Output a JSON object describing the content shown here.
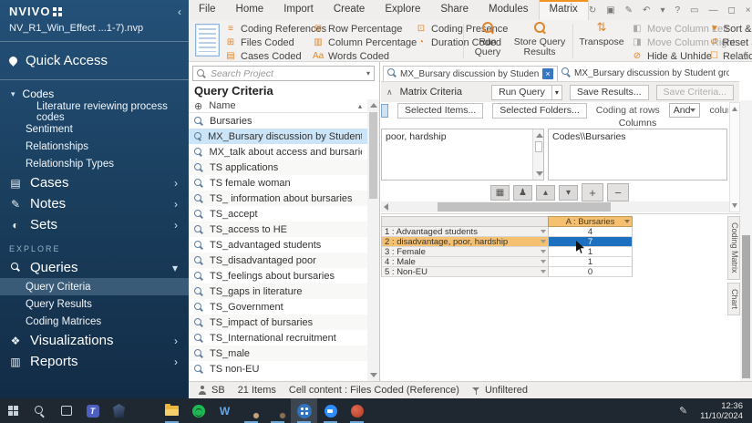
{
  "sidebar": {
    "logo_text": "NVIVO",
    "collapse_glyph": "‹",
    "project_name": "NV_R1_Win_Effect ...1-7).nvp",
    "quick_access_label": "Quick Access",
    "codes": {
      "label": "Codes",
      "chevron": "▾"
    },
    "codes_children": [
      {
        "label": "Literature reviewing process codes",
        "deep": true
      },
      {
        "label": "Sentiment"
      },
      {
        "label": "Relationships"
      },
      {
        "label": "Relationship Types"
      }
    ],
    "sections": [
      {
        "label": "Cases",
        "glyph": "▤",
        "chevron": "›"
      },
      {
        "label": "Notes",
        "glyph": "✎",
        "chevron": "›"
      },
      {
        "label": "Sets",
        "glyph": "◐",
        "chevron": "›"
      }
    ],
    "explore_label": "EXPLORE",
    "queries": {
      "label": "Queries",
      "chevron": "▾"
    },
    "queries_children": [
      {
        "label": "Query Criteria",
        "selected": true
      },
      {
        "label": "Query Results"
      },
      {
        "label": "Coding Matrices"
      }
    ],
    "bottom_sections": [
      {
        "label": "Visualizations",
        "glyph": "❖",
        "chevron": "›"
      },
      {
        "label": "Reports",
        "glyph": "▥",
        "chevron": "›"
      }
    ]
  },
  "ribbon": {
    "tabs": [
      {
        "label": "File"
      },
      {
        "label": "Home"
      },
      {
        "label": "Import"
      },
      {
        "label": "Create"
      },
      {
        "label": "Explore"
      },
      {
        "label": "Share"
      },
      {
        "label": "Modules"
      },
      {
        "label": "Matrix",
        "active": true
      }
    ],
    "window_icons": [
      {
        "glyph": "↻"
      },
      {
        "glyph": "▣"
      },
      {
        "glyph": "✎"
      },
      {
        "glyph": "↶"
      },
      {
        "glyph": "▾"
      },
      {
        "glyph": "?"
      },
      {
        "glyph": "▭"
      },
      {
        "glyph": "—"
      },
      {
        "glyph": "◻"
      },
      {
        "glyph": "×"
      }
    ],
    "display_group_a": [
      {
        "glyph": "≡",
        "label": "Coding References"
      },
      {
        "glyph": "⊞",
        "label": "Files Coded"
      },
      {
        "glyph": "▤",
        "label": "Cases Coded"
      }
    ],
    "display_group_b": [
      {
        "glyph": "⊟",
        "label": "Row Percentage"
      },
      {
        "glyph": "▥",
        "label": "Column Percentage"
      },
      {
        "glyph": "Aa",
        "label": "Words Coded"
      }
    ],
    "display_group_c": [
      {
        "glyph": "⊡",
        "label": "Coding Presence"
      },
      {
        "glyph": "◔",
        "label": "Duration Coded"
      }
    ],
    "run_query_label": "Run Query",
    "store_query_results_label": "Store Query Results",
    "transpose_label": "Transpose",
    "transpose_glyph": "⇅",
    "column_group": [
      {
        "glyph": "◧",
        "label": "Move Column Left",
        "disabled": true
      },
      {
        "glyph": "◨",
        "label": "Move Column Right",
        "disabled": true
      },
      {
        "glyph": "⊘",
        "label": "Hide & Unhide"
      }
    ],
    "tools_group": [
      {
        "glyph": "▼",
        "label": "Sort & Filter"
      },
      {
        "glyph": "↺",
        "label": "Reset Settings"
      },
      {
        "glyph": "☐",
        "label": "Relationships"
      }
    ],
    "collapse_glyph": "∧"
  },
  "navigator": {
    "search_placeholder": "Search Project",
    "search_dropdown_glyph": "▾",
    "title": "Query Criteria",
    "name_header": {
      "icon_glyph": "⊕",
      "label": "Name",
      "sort_glyph": "▴"
    },
    "items": [
      {
        "label": "Bursaries"
      },
      {
        "label": "MX_Bursary discussion by Student groups",
        "selected": true
      },
      {
        "label": "MX_talk about access and bursaries"
      },
      {
        "label": "TS applications"
      },
      {
        "label": "TS female woman"
      },
      {
        "label": "TS_ information about bursaries"
      },
      {
        "label": "TS_accept"
      },
      {
        "label": "TS_access to HE"
      },
      {
        "label": "TS_advantaged students"
      },
      {
        "label": "TS_disadvantaged poor"
      },
      {
        "label": "TS_feelings about bursaries"
      },
      {
        "label": "TS_gaps in literature"
      },
      {
        "label": "TS_Government"
      },
      {
        "label": "TS_impact of bursaries"
      },
      {
        "label": "TS_International recruitment"
      },
      {
        "label": "TS_male"
      },
      {
        "label": "TS non-EU"
      }
    ]
  },
  "doc_tabs": [
    {
      "label": "MX_Bursary discussion by Student groups - Resul",
      "active": true,
      "close_glyph": "×"
    },
    {
      "label": "MX_Bursary discussion by Student groups - Resu"
    }
  ],
  "criteria": {
    "collapse_glyph": "∧",
    "title": "Matrix Criteria",
    "run_query_label": "Run Query",
    "run_query_dropdown": "▾",
    "save_results_label": "Save Results...",
    "save_criteria_label": "Save Criteria...",
    "selected_items_label": "Selected Items...",
    "selected_folders_label": "Selected Folders...",
    "coding_at_rows_text": "Coding at rows",
    "operator_value": "And",
    "columns_text": "columns",
    "clipped_text": "L",
    "columns_box_label": "Columns",
    "rows_list_value": "poor,  hardship",
    "columns_list_value": "Codes\\\\Bursaries",
    "toolbar": [
      {
        "glyph": "▦"
      },
      {
        "glyph": "♟"
      },
      {
        "glyph": "▴"
      },
      {
        "glyph": "▾"
      },
      {
        "glyph": "+"
      },
      {
        "glyph": "−"
      }
    ]
  },
  "results_table": {
    "column_header": "A : Bursaries",
    "rows": [
      {
        "label": "1 : Advantaged students",
        "value": "4"
      },
      {
        "label": "2 : disadvantage, poor, hardship",
        "value": "7",
        "row_selected": true,
        "cell_selected": true
      },
      {
        "label": "3 : Female",
        "value": "1"
      },
      {
        "label": "4 : Male",
        "value": "1"
      },
      {
        "label": "5 : Non-EU",
        "value": "0"
      }
    ]
  },
  "side_tabs": [
    {
      "label": "Coding Matrix"
    },
    {
      "label": "Chart"
    }
  ],
  "status_bar": {
    "user_initials": "SB",
    "items_count": "21 Items",
    "cell_content": "Cell content : Files Coded (Reference)",
    "filter_label": "Unfiltered"
  },
  "taskbar": {
    "icons": [
      {
        "name": "start-icon"
      },
      {
        "name": "search-icon"
      },
      {
        "name": "task-view-icon"
      },
      {
        "name": "teams-icon"
      },
      {
        "name": "obsidian-icon"
      },
      {
        "name": "chrome-icon"
      },
      {
        "name": "file-explorer-icon",
        "open": true
      },
      {
        "name": "spotify-icon"
      },
      {
        "name": "word-icon"
      },
      {
        "name": "chrome-profile1-icon",
        "open": true
      },
      {
        "name": "chrome-profile2-icon",
        "open": true
      },
      {
        "name": "nvivo-icon",
        "open": true,
        "active": true
      },
      {
        "name": "zoom-icon",
        "open": true
      },
      {
        "name": "powerpoint-icon",
        "open": true
      }
    ],
    "clock_time": "12:36",
    "clock_date": "11/10/2024"
  }
}
